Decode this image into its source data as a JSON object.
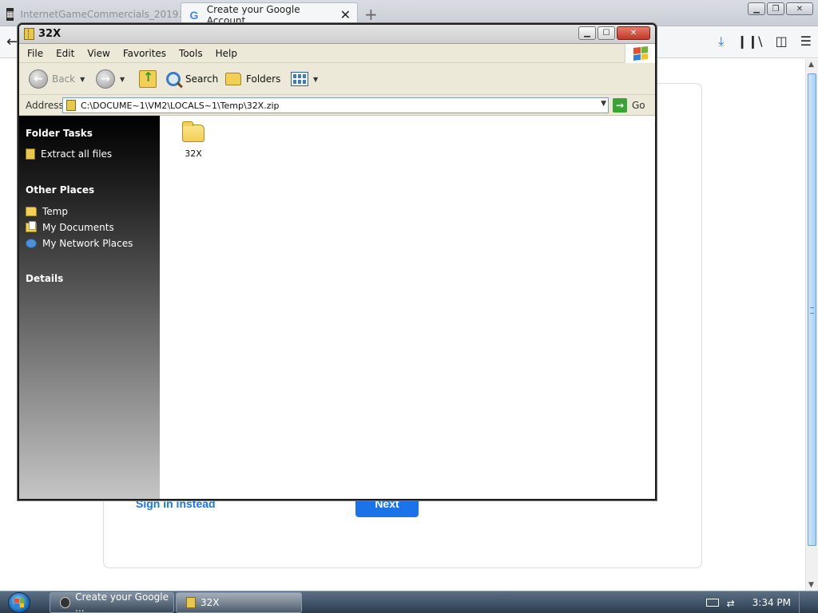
{
  "browser": {
    "tabs": [
      {
        "label": "InternetGameCommercials_2019",
        "active": false
      },
      {
        "label": "Create your Google Account",
        "active": true
      }
    ],
    "new_tab_symbol": "+",
    "nav_icons": [
      "back-arrow-icon",
      "download-icon",
      "library-icon",
      "sidebar-icon",
      "hamburger-menu-icon"
    ],
    "page": {
      "signin_link": "Sign in instead",
      "next_button": "Next"
    }
  },
  "explorer": {
    "title": "32X",
    "menu": [
      "File",
      "Edit",
      "View",
      "Favorites",
      "Tools",
      "Help"
    ],
    "toolbar": {
      "back": "Back",
      "search": "Search",
      "folders": "Folders"
    },
    "address": {
      "label": "Address",
      "value": "C:\\DOCUME~1\\VM2\\LOCALS~1\\Temp\\32X.zip",
      "go": "Go"
    },
    "sidebar": {
      "folder_tasks": {
        "header": "Folder Tasks",
        "items": [
          {
            "label": "Extract all files",
            "icon": "zip-icon"
          }
        ]
      },
      "other_places": {
        "header": "Other Places",
        "items": [
          {
            "label": "Temp",
            "icon": "folder-icon"
          },
          {
            "label": "My Documents",
            "icon": "my-documents-icon"
          },
          {
            "label": "My Network Places",
            "icon": "network-places-icon"
          }
        ]
      },
      "details": {
        "header": "Details"
      }
    },
    "content": {
      "items": [
        {
          "label": "32X",
          "icon": "folder-icon"
        }
      ]
    }
  },
  "taskbar": {
    "tasks": [
      {
        "label": "Create your Google ...",
        "icon": "browser-icon"
      },
      {
        "label": "32X",
        "icon": "zip-folder-icon"
      }
    ],
    "clock": "3:34 PM"
  },
  "colors": {
    "google_blue": "#1a73e8",
    "explorer_sidebar_top": "#000000",
    "taskbar": "#2c3c4e"
  }
}
